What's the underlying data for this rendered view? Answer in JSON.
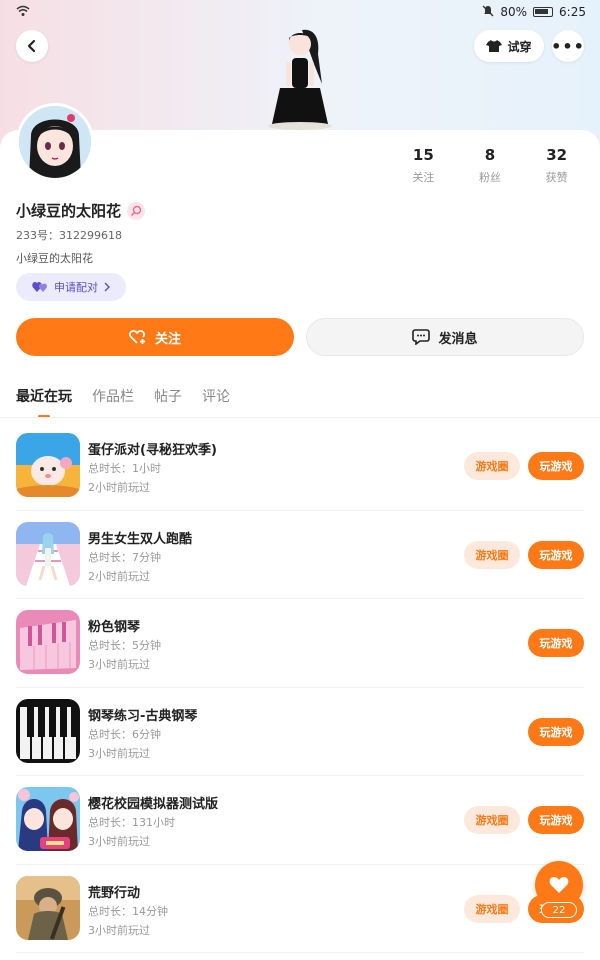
{
  "status_bar": {
    "battery": "80%",
    "time": "6:25"
  },
  "header": {
    "tryon_label": "试穿",
    "more_label": "•••"
  },
  "profile": {
    "username": "小绿豆的太阳花",
    "uid": "233号：312299618",
    "bio": "小绿豆的太阳花",
    "match_label": "申请配对",
    "stats": [
      {
        "num": "15",
        "label": "关注"
      },
      {
        "num": "8",
        "label": "粉丝"
      },
      {
        "num": "32",
        "label": "获赞"
      }
    ]
  },
  "actions": {
    "follow_label": "关注",
    "message_label": "发消息"
  },
  "tabs": [
    "最近在玩",
    "作品栏",
    "帖子",
    "评论"
  ],
  "games": [
    {
      "title": "蛋仔派对(寻秘狂欢季)",
      "duration": "总时长：1小时",
      "last": "2小时前玩过",
      "circle": "游戏圈",
      "play": "玩游戏",
      "icon": "eggy-party-icon"
    },
    {
      "title": "男生女生双人跑酷",
      "duration": "总时长：7分钟",
      "last": "2小时前玩过",
      "circle": "游戏圈",
      "play": "玩游戏",
      "icon": "runner-icon"
    },
    {
      "title": "粉色钢琴",
      "duration": "总时长：5分钟",
      "last": "3小时前玩过",
      "circle": "",
      "play": "玩游戏",
      "icon": "pink-piano-icon"
    },
    {
      "title": "钢琴练习-古典钢琴",
      "duration": "总时长：6分钟",
      "last": "3小时前玩过",
      "circle": "",
      "play": "玩游戏",
      "icon": "piano-keys-icon"
    },
    {
      "title": "樱花校园模拟器测试版",
      "duration": "总时长：131小时",
      "last": "3小时前玩过",
      "circle": "游戏圈",
      "play": "玩游戏",
      "icon": "sakura-school-icon"
    },
    {
      "title": "荒野行动",
      "duration": "总时长：14分钟",
      "last": "3小时前玩过",
      "circle": "游戏圈",
      "play": "玩游戏",
      "icon": "knives-out-icon"
    }
  ],
  "fab": {
    "count": "22"
  },
  "colors": {
    "accent": "#ff7a17",
    "match": "#5b4ec9"
  }
}
